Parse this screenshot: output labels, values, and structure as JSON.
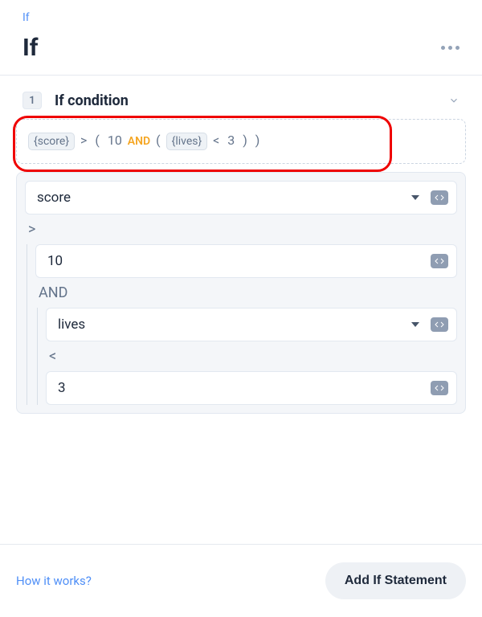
{
  "breadcrumb": "If",
  "title": "If",
  "section": {
    "number": "1",
    "title": "If condition"
  },
  "expression": {
    "chip_score": "{score}",
    "gt": ">",
    "lp1": "(",
    "val10": "10",
    "and": "AND",
    "lp2": "(",
    "chip_lives": "{lives}",
    "lt": "<",
    "val3": "3",
    "rp1": ")",
    "rp2": ")"
  },
  "builder": {
    "row1": {
      "value": "score"
    },
    "op1": ">",
    "row2": {
      "value": "10"
    },
    "op2": "AND",
    "row3": {
      "value": "lives"
    },
    "op3": "<",
    "row4": {
      "value": "3"
    }
  },
  "footer": {
    "help": "How it works?",
    "add_button": "Add If Statement"
  }
}
